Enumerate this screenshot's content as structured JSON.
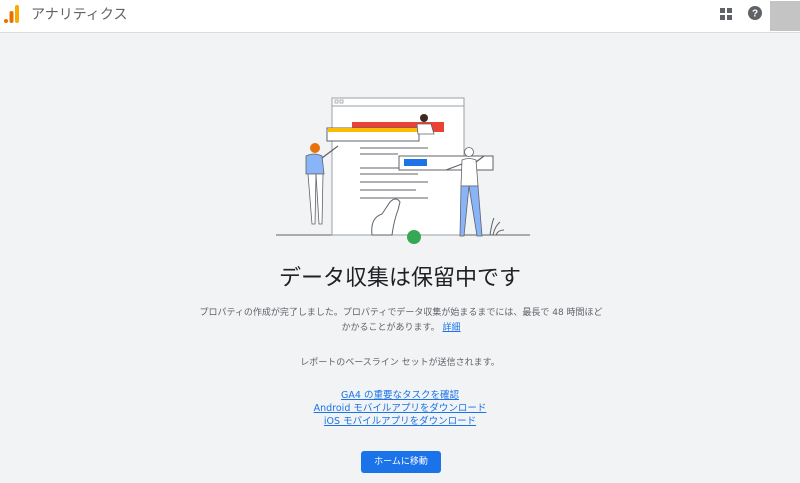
{
  "header": {
    "app_title": "アナリティクス",
    "logo_icon": "google-analytics-logo",
    "apps_icon": "apps-grid-icon",
    "help_icon": "help-icon"
  },
  "main": {
    "heading": "データ収集は保留中です",
    "description": "プロパティの作成が完了しました。プロパティでデータ収集が始まるまでには、最長で 48 時間ほどかかることがあります。",
    "details_link": "詳細",
    "baseline_text": "レポートのベースライン セットが送信されます。",
    "links": [
      "GA4 の重要なタスクを確認",
      "Android モバイルアプリをダウンロード",
      "iOS モバイルアプリをダウンロード"
    ],
    "home_button": "ホームに移動"
  },
  "colors": {
    "accent": "#1a73e8",
    "logo_orange": "#f9ab00",
    "logo_dark": "#e37400",
    "illustration_red": "#ea4335",
    "illustration_yellow": "#fbbc04",
    "illustration_green": "#34a853"
  }
}
